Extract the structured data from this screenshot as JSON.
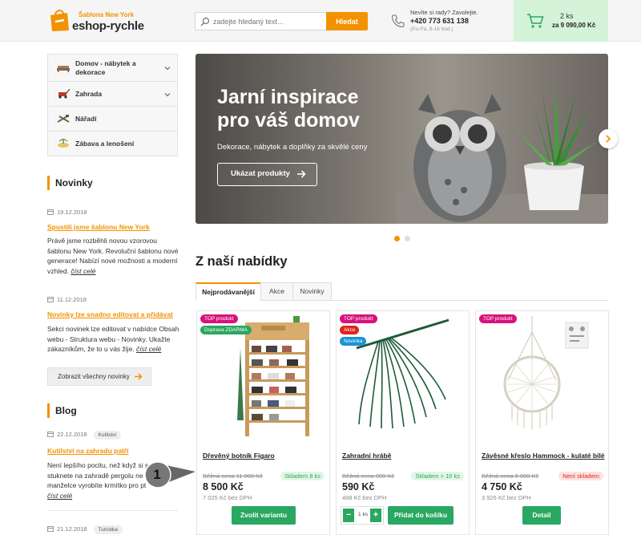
{
  "header": {
    "logo_small_prefix": "Šablona",
    "logo_small_highlight": "New York",
    "logo_big": "eshop-rychle",
    "search_placeholder": "zadejte hledaný text...",
    "search_button": "Hledat",
    "phone_question": "Nevíte si rady? Zavolejte.",
    "phone_number": "+420 773 631 138",
    "phone_hours": "(Po-Pá, 8-16 hod.)",
    "cart_count": "2 ks",
    "cart_total": "za 9 090,00 Kč"
  },
  "categories": [
    {
      "label": "Domov - nábytek a dekorace",
      "icon": "furniture-icon",
      "expandable": true
    },
    {
      "label": "Zahrada",
      "icon": "lawnmower-icon",
      "expandable": true
    },
    {
      "label": "Nářadí",
      "icon": "tools-icon",
      "expandable": false
    },
    {
      "label": "Zábava a lenošení",
      "icon": "leisure-icon",
      "expandable": false
    }
  ],
  "news": {
    "heading": "Novinky",
    "items": [
      {
        "date": "19.12.2018",
        "title": "Spustili jsme šablonu New York",
        "text": "Právě jsme rozběhli novou vzorovou šablonu New York. Revoluční šablonu nové generace! Nabízí nové možnosti a moderní vzhled.",
        "more": "číst celé"
      },
      {
        "date": "11.12.2018",
        "title": "Novinky lze snadno editovat a přidávat",
        "text": "Sekci novinek lze editovat v nabídce Obsah webu - Struktura webu - Novinky. Ukažte zákazníkům, že to u vás žije.",
        "more": "číst celé"
      }
    ],
    "all_button": "Zobrazit všechny novinky"
  },
  "blog": {
    "heading": "Blog",
    "items": [
      {
        "date": "22.12.2018",
        "tag": "Kutilství",
        "title": "Kutilství na zahradu patří",
        "text_lines": [
          "Není lepšího pocitu, než když si s",
          "stuknete na zahradě pergolu ne",
          "manželce vyrobíte krmítko pro pt"
        ],
        "more": "číst celé"
      },
      {
        "date": "21.12.2018",
        "tag": "Turistika"
      }
    ]
  },
  "banner": {
    "title_line1": "Jarní inspirace",
    "title_line2": "pro váš domov",
    "subtitle": "Dekorace, nábytek a doplňky za skvělé ceny",
    "button": "Ukázat produkty"
  },
  "offers": {
    "title": "Z naší nabídky",
    "tabs": [
      "Nejprodávanější",
      "Akce",
      "Novinky"
    ],
    "active_tab": 0
  },
  "products": [
    {
      "badges": [
        "TOP produkt",
        "Doprava ZDARMA"
      ],
      "name": "Dřevěný botník Figaro",
      "old_price": "Běžná cena 11 000 Kč",
      "stock": "Skladem 8 ks",
      "price": "8 500 Kč",
      "price_net": "7 025 Kč bez DPH",
      "action": "Zvolit variantu"
    },
    {
      "badges": [
        "TOP produkt",
        "Akce",
        "Novinka"
      ],
      "name": "Zahradní hrábě",
      "old_price": "Běžná cena 900 Kč",
      "stock": "Skladem > 10 ks",
      "price": "590 Kč",
      "price_net": "488 Kč bez DPH",
      "qty_value": "1 ks",
      "action": "Přidat do košíku"
    },
    {
      "badges": [
        "TOP produkt"
      ],
      "name": "Závěsné křeslo Hammock - kulaté bílé",
      "old_price": "Běžná cena 6 000 Kč",
      "stock": "Není skladem",
      "price": "4 750 Kč",
      "price_net": "3 926 Kč bez DPH",
      "action": "Detail"
    }
  ],
  "callout": {
    "number": "1"
  },
  "colors": {
    "accent": "#f39200",
    "green": "#2aa760",
    "top_badge": "#d8127c",
    "sale_badge": "#e2231a",
    "new_badge": "#1a93d4",
    "cart_bg": "#d4f3d9"
  }
}
